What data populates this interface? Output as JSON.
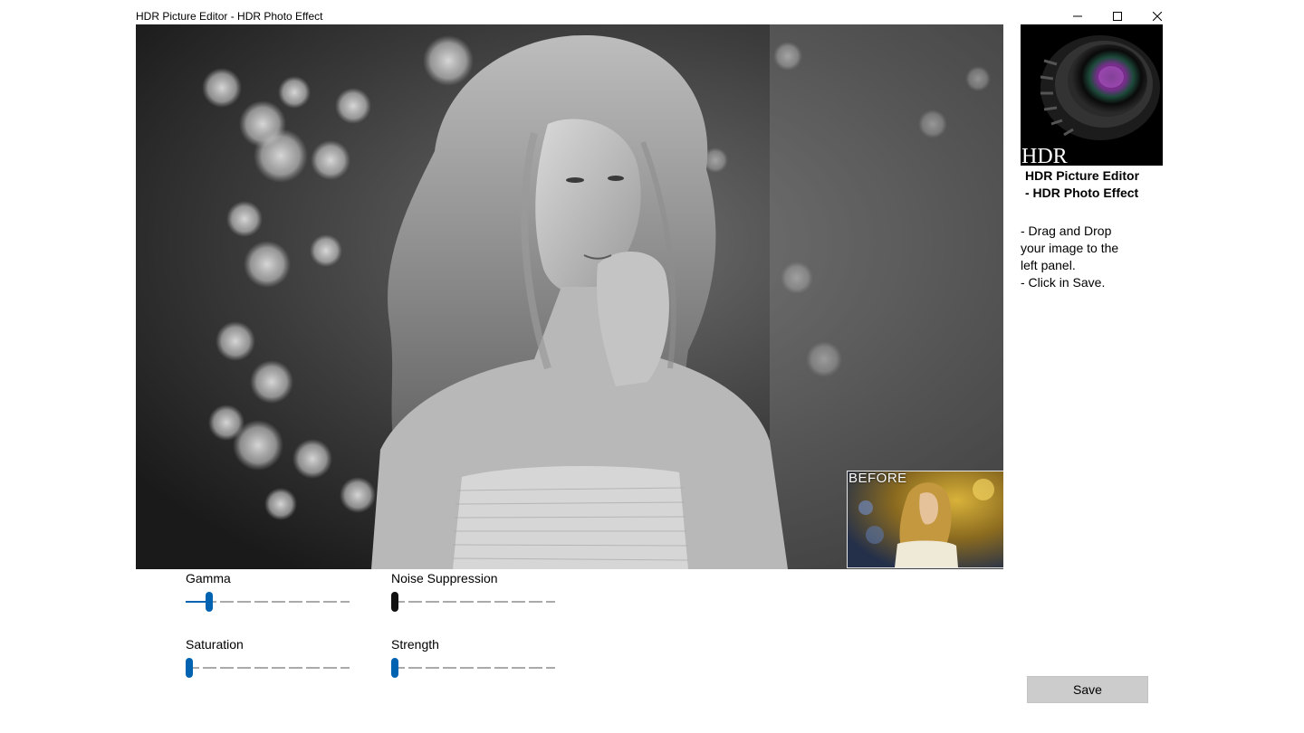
{
  "window": {
    "title": "HDR Picture Editor - HDR Photo Effect",
    "controls": {
      "minimize_icon": "minimize-icon",
      "maximize_icon": "maximize-icon",
      "close_icon": "close-icon"
    }
  },
  "preview": {
    "before_label": "BEFORE"
  },
  "sidebar": {
    "logo_text": "HDR",
    "heading": "HDR Picture Editor\n- HDR Photo Effect",
    "instructions": " - Drag and Drop\nyour image to the\nleft panel.\n- Click in Save."
  },
  "sliders": [
    {
      "label": "Gamma",
      "value": 0.12,
      "style": "accent"
    },
    {
      "label": "Noise Suppression",
      "value": 0.0,
      "style": "dark"
    },
    {
      "label": "Saturation",
      "value": 0.0,
      "style": "accent"
    },
    {
      "label": "Strength",
      "value": 0.0,
      "style": "accent"
    }
  ],
  "save_label": "Save",
  "colors": {
    "accent": "#0063b1",
    "save_button_bg": "#cccccc"
  }
}
